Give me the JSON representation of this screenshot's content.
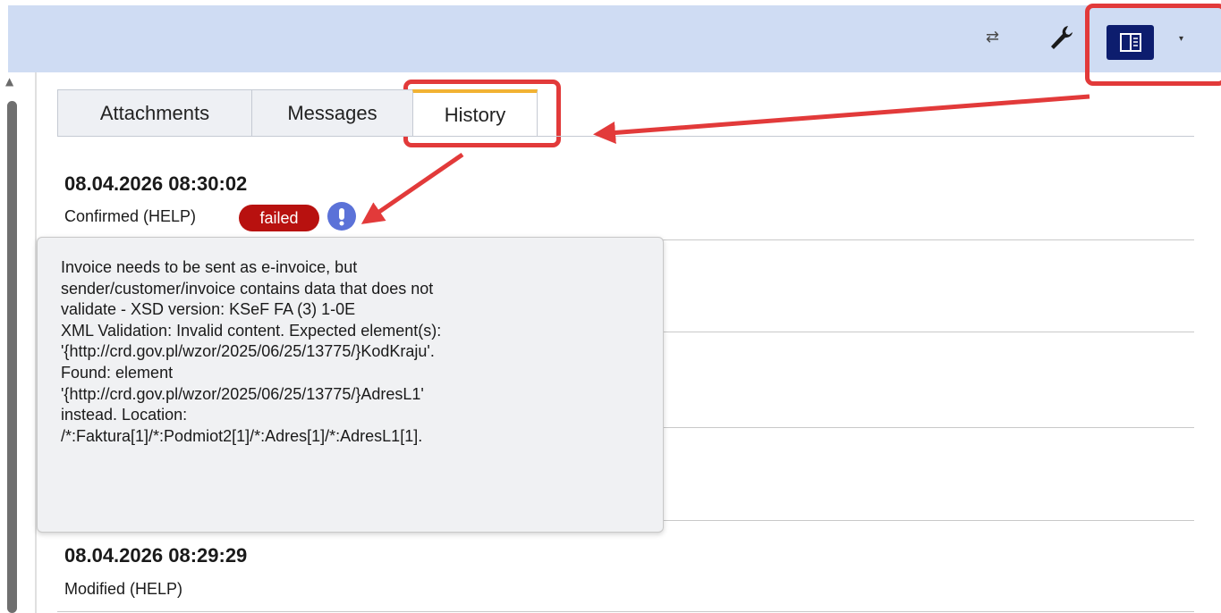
{
  "toolbar": {
    "swap_icon": "swap-arrows-icon",
    "wrench_icon": "wrench-icon",
    "panel_icon": "side-panel-icon",
    "caret_icon": "chevron-down-icon"
  },
  "tabs": [
    {
      "label": "Attachments",
      "active": false
    },
    {
      "label": "Messages",
      "active": false
    },
    {
      "label": "History",
      "active": true
    }
  ],
  "history": [
    {
      "date": "08.04.2026 08:30:02",
      "status": "Confirmed (HELP)",
      "badge": "failed"
    },
    {
      "date": "08.04.2026 08:29:29",
      "status": "Modified (HELP)"
    }
  ],
  "tooltip": {
    "lines": [
      "Invoice needs to be sent as e-invoice, but",
      "sender/customer/invoice contains data that does not",
      "validate - XSD version: KSeF FA (3) 1-0E",
      "XML Validation: Invalid content. Expected element(s):",
      "'{http://crd.gov.pl/wzor/2025/06/25/13775/}KodKraju'.",
      "Found: element",
      "'{http://crd.gov.pl/wzor/2025/06/25/13775/}AdresL1'",
      "instead. Location:",
      "/*:Faktura[1]/*:Podmiot2[1]/*:Adres[1]/*:AdresL1[1]."
    ]
  },
  "colors": {
    "toolbar_bg": "#cfdcf3",
    "accent_navy": "#0d1d6e",
    "failed_badge": "#b8110f",
    "annotation_red": "#e23a3a",
    "active_tab_top": "#f2b233"
  }
}
